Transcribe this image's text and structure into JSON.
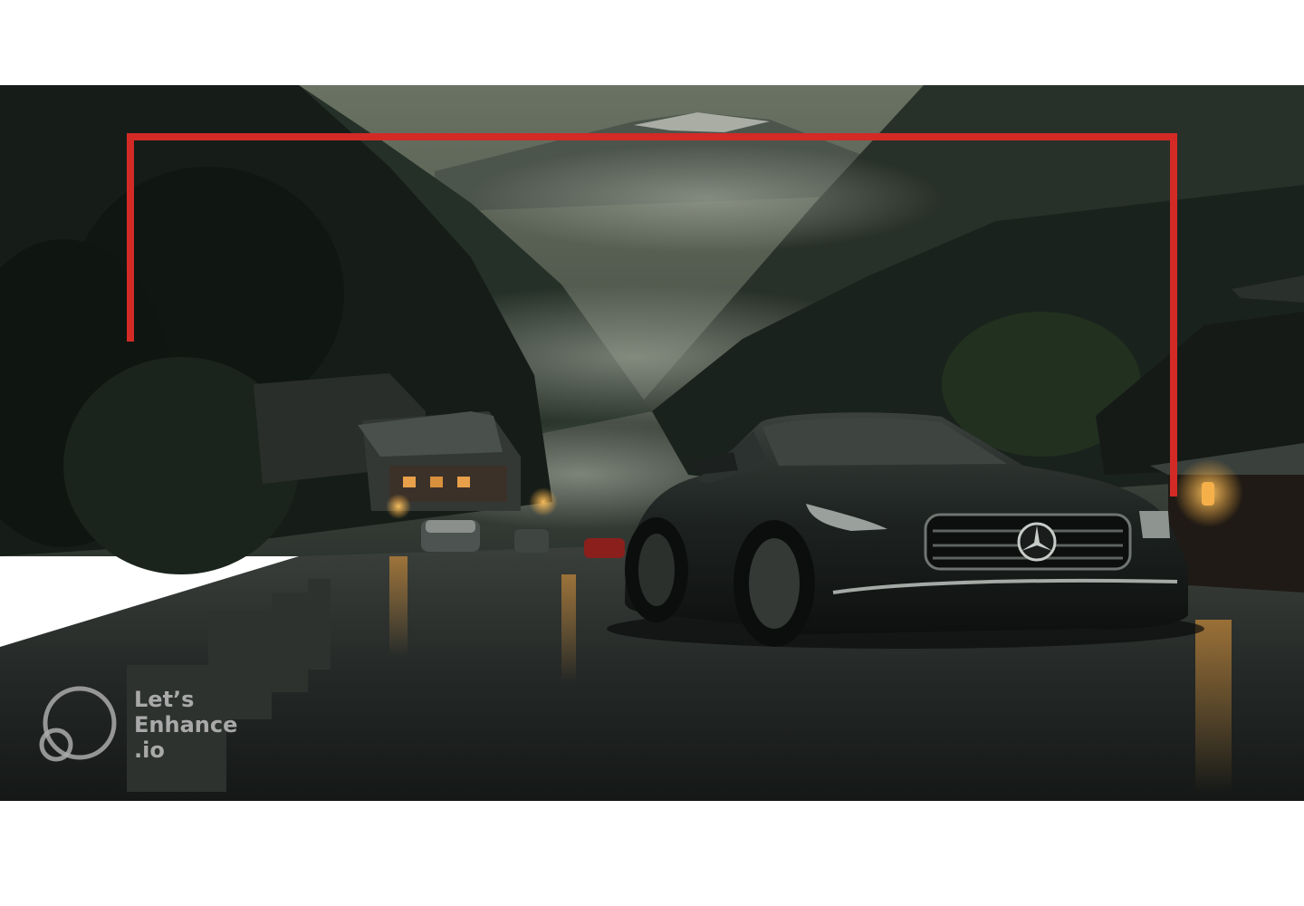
{
  "image": {
    "subject": "dark sedan on wet mountain village road",
    "colors": {
      "frame": "#d32a26",
      "sky": "#5d6658",
      "mist": "#8a9183",
      "mountain": "#1d2621",
      "road": "#1e2220",
      "car_body": "#1a1f1c",
      "lamp": "#f2a23a"
    },
    "icons": [
      "mercedes-star-icon",
      "letsenhance-logo-icon"
    ]
  },
  "watermark": {
    "line1": "Let’s",
    "line2": "Enhance",
    "line3": ".io"
  }
}
